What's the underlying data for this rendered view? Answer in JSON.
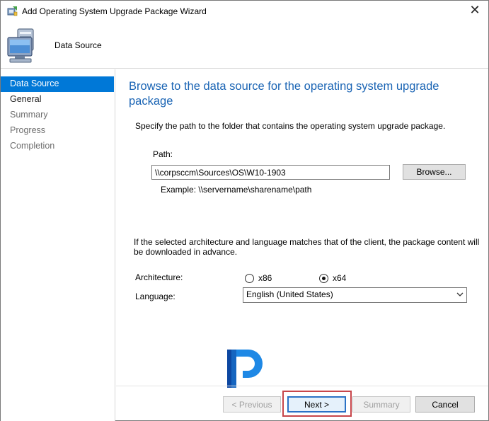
{
  "window": {
    "title": "Add Operating System Upgrade Package Wizard",
    "close_glyph": "✕"
  },
  "header": {
    "title": "Data Source"
  },
  "nav": {
    "items": [
      {
        "label": "Data Source",
        "state": "active"
      },
      {
        "label": "General",
        "state": "normal"
      },
      {
        "label": "Summary",
        "state": "dim"
      },
      {
        "label": "Progress",
        "state": "dim"
      },
      {
        "label": "Completion",
        "state": "dim"
      }
    ]
  },
  "content": {
    "heading_line1": "Browse to the data source for the operating system upgrade",
    "heading_line2": "package",
    "description": "Specify the path to the folder that contains the operating system upgrade package.",
    "path_label": "Path:",
    "path_value": "\\\\corpsccm\\Sources\\OS\\W10-1903",
    "browse_label": "Browse...",
    "example": "Example: \\\\servername\\sharename\\path",
    "info_text": "If the selected architecture and language matches that of the client, the package content will be downloaded in advance.",
    "architecture_label": "Architecture:",
    "arch_options": [
      {
        "label": "x86",
        "checked": false
      },
      {
        "label": "x64",
        "checked": true
      }
    ],
    "language_label": "Language:",
    "language_value": "English (United States)"
  },
  "footer": {
    "previous_label": "< Previous",
    "next_label": "Next >",
    "summary_label": "Summary",
    "cancel_label": "Cancel"
  },
  "colors": {
    "accent": "#0078d7",
    "heading": "#1a64b4",
    "highlight_box": "#c7464b"
  }
}
